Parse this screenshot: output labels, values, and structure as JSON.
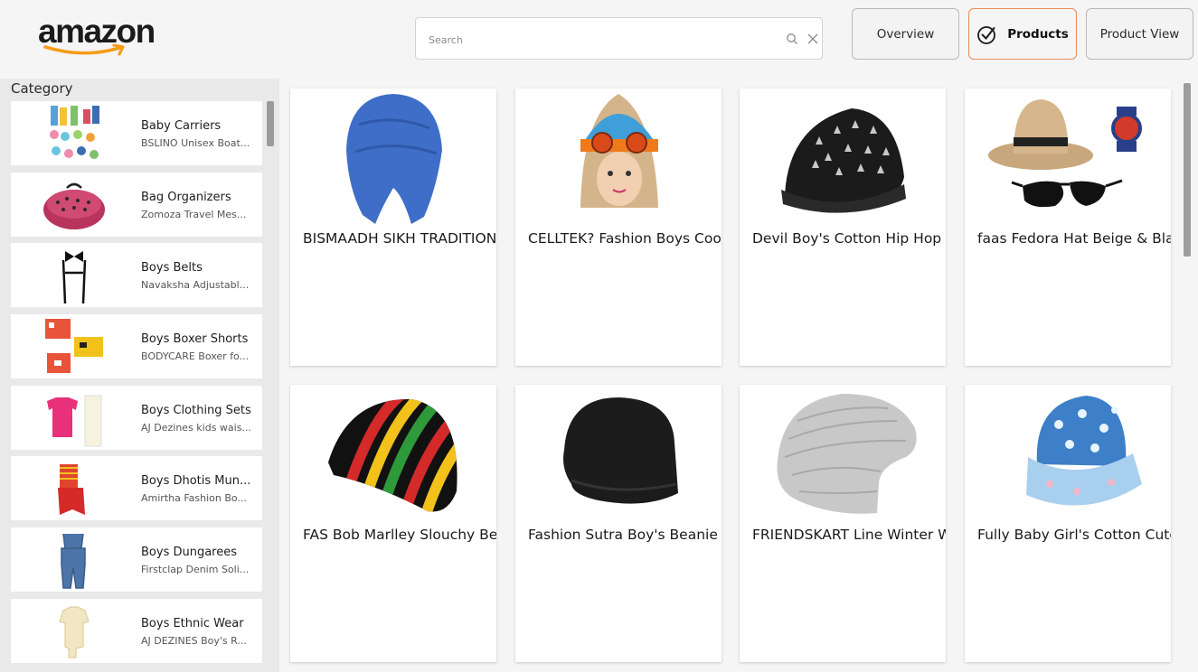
{
  "brand": {
    "logo_text": "amazon",
    "accent_color": "#f59c1a"
  },
  "search": {
    "placeholder": "Search"
  },
  "nav": {
    "overview": "Overview",
    "products": "Products",
    "product_view": "Product View",
    "active": "products",
    "active_border_color": "#e58f5a"
  },
  "sidebar": {
    "title": "Category",
    "items": [
      {
        "name": "Baby Carriers",
        "sub": "BSLINO Unisex Boat...",
        "icon": "socks-image"
      },
      {
        "name": "Bag Organizers",
        "sub": "Zomoza Travel Mes...",
        "icon": "bra-case-image"
      },
      {
        "name": "Boys Belts",
        "sub": "Navaksha Adjustabl...",
        "icon": "suspenders-image"
      },
      {
        "name": "Boys Boxer Shorts",
        "sub": "BODYCARE Boxer fo...",
        "icon": "boxer-shorts-image"
      },
      {
        "name": "Boys Clothing Sets",
        "sub": "AJ Dezines kids wais...",
        "icon": "shirt-set-image"
      },
      {
        "name": "Boys Dhotis Mun...",
        "sub": "Amirtha Fashion Bo...",
        "icon": "dhoti-image"
      },
      {
        "name": "Boys Dungarees",
        "sub": "Firstclap Denim Soli...",
        "icon": "dungarees-image"
      },
      {
        "name": "Boys Ethnic Wear",
        "sub": "AJ DEZINES Boy's R...",
        "icon": "ethnic-wear-image"
      }
    ]
  },
  "products": [
    {
      "title": "BISMAADH SIKH TRADITION",
      "icon": "turban-image"
    },
    {
      "title": "CELLTEK? Fashion Boys Cool",
      "icon": "aviator-hat-child-image"
    },
    {
      "title": "Devil Boy's Cotton Hip Hop C",
      "icon": "spiked-cap-image"
    },
    {
      "title": "faas Fedora Hat Beige & Blac",
      "icon": "fedora-combo-image"
    },
    {
      "title": "FAS Bob Marlley Slouchy Bea",
      "icon": "rasta-beanie-image"
    },
    {
      "title": "Fashion Sutra Boy's Beanie C",
      "icon": "black-beanie-image"
    },
    {
      "title": "FRIENDSKART Line Winter W",
      "icon": "grey-slouchy-beanie-image"
    },
    {
      "title": "Fully Baby Girl's Cotton Cute",
      "icon": "baby-bucket-hat-image"
    }
  ]
}
